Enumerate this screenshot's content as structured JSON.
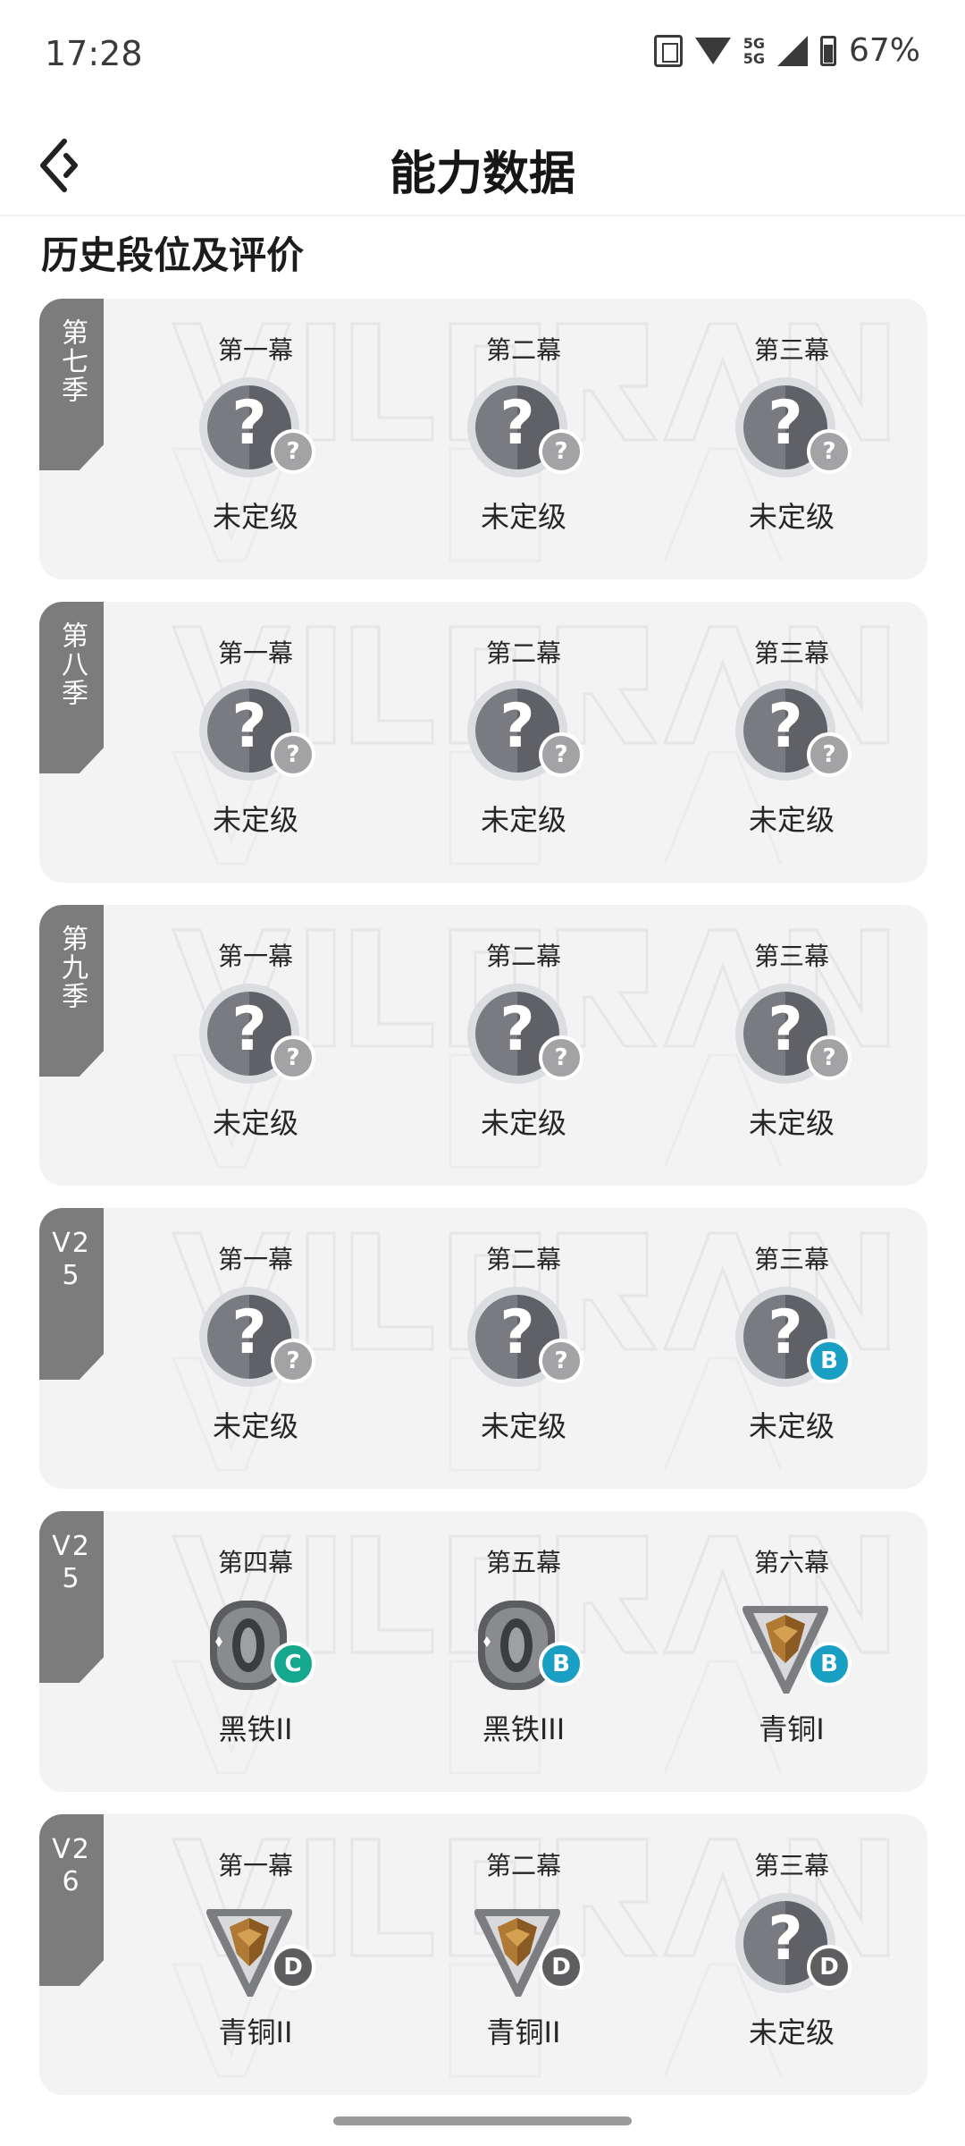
{
  "status_bar": {
    "time": "17:28",
    "network": "5G",
    "battery": "67%"
  },
  "header": {
    "title": "能力数据"
  },
  "section_title": "历史段位及评价",
  "colors": {
    "tag_bg": "#7c7c7c",
    "card_bg": "#f3f3f4",
    "badge_unknown": "#a3a3a6",
    "badge_b": "#1a9fc4",
    "badge_c": "#15a88f",
    "badge_d": "#5e5e60"
  },
  "seasons": [
    {
      "tag": "第七季",
      "acts": [
        {
          "label": "第一幕",
          "rank": "未定级",
          "rank_icon": "unranked-icon",
          "badge": "?",
          "badge_color": "#a3a3a6"
        },
        {
          "label": "第二幕",
          "rank": "未定级",
          "rank_icon": "unranked-icon",
          "badge": "?",
          "badge_color": "#a3a3a6"
        },
        {
          "label": "第三幕",
          "rank": "未定级",
          "rank_icon": "unranked-icon",
          "badge": "?",
          "badge_color": "#a3a3a6"
        }
      ]
    },
    {
      "tag": "第八季",
      "acts": [
        {
          "label": "第一幕",
          "rank": "未定级",
          "rank_icon": "unranked-icon",
          "badge": "?",
          "badge_color": "#a3a3a6"
        },
        {
          "label": "第二幕",
          "rank": "未定级",
          "rank_icon": "unranked-icon",
          "badge": "?",
          "badge_color": "#a3a3a6"
        },
        {
          "label": "第三幕",
          "rank": "未定级",
          "rank_icon": "unranked-icon",
          "badge": "?",
          "badge_color": "#a3a3a6"
        }
      ]
    },
    {
      "tag": "第九季",
      "acts": [
        {
          "label": "第一幕",
          "rank": "未定级",
          "rank_icon": "unranked-icon",
          "badge": "?",
          "badge_color": "#a3a3a6"
        },
        {
          "label": "第二幕",
          "rank": "未定级",
          "rank_icon": "unranked-icon",
          "badge": "?",
          "badge_color": "#a3a3a6"
        },
        {
          "label": "第三幕",
          "rank": "未定级",
          "rank_icon": "unranked-icon",
          "badge": "?",
          "badge_color": "#a3a3a6"
        }
      ]
    },
    {
      "tag": "V25",
      "acts": [
        {
          "label": "第一幕",
          "rank": "未定级",
          "rank_icon": "unranked-icon",
          "badge": "?",
          "badge_color": "#a3a3a6"
        },
        {
          "label": "第二幕",
          "rank": "未定级",
          "rank_icon": "unranked-icon",
          "badge": "?",
          "badge_color": "#a3a3a6"
        },
        {
          "label": "第三幕",
          "rank": "未定级",
          "rank_icon": "unranked-icon",
          "badge": "B",
          "badge_color": "#1a9fc4"
        }
      ]
    },
    {
      "tag": "V25",
      "acts": [
        {
          "label": "第四幕",
          "rank": "黑铁II",
          "rank_icon": "iron-rank-icon",
          "badge": "C",
          "badge_color": "#15a88f"
        },
        {
          "label": "第五幕",
          "rank": "黑铁III",
          "rank_icon": "iron-rank-icon",
          "badge": "B",
          "badge_color": "#1a9fc4"
        },
        {
          "label": "第六幕",
          "rank": "青铜I",
          "rank_icon": "bronze-rank-icon",
          "badge": "B",
          "badge_color": "#1a9fc4"
        }
      ]
    },
    {
      "tag": "V26",
      "acts": [
        {
          "label": "第一幕",
          "rank": "青铜II",
          "rank_icon": "bronze-rank-icon",
          "badge": "D",
          "badge_color": "#5e5e60"
        },
        {
          "label": "第二幕",
          "rank": "青铜II",
          "rank_icon": "bronze-rank-icon",
          "badge": "D",
          "badge_color": "#5e5e60"
        },
        {
          "label": "第三幕",
          "rank": "未定级",
          "rank_icon": "unranked-icon",
          "badge": "D",
          "badge_color": "#5e5e60"
        }
      ]
    }
  ]
}
